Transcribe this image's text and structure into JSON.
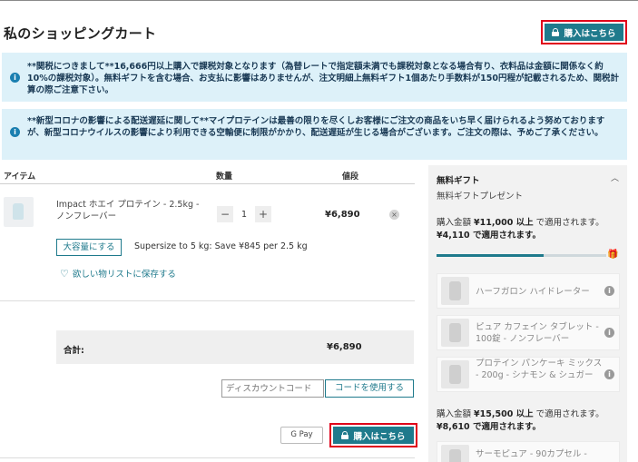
{
  "page": {
    "title": "私のショッピングカート"
  },
  "checkout": {
    "label": "購入はこちら"
  },
  "notices": [
    {
      "text": "**関税につきまして**16,666円以上購入で課税対象となります（為替レートで指定額未満でも課税対象となる場合有り、衣料品は金額に関係なく約10%の課税対象）。無料ギフトを含む場合、お支払に影響はありませんが、注文明細上無料ギフト1個あたり手数料が150円程が記載されるため、関税計算の際ご注意下さい。"
    },
    {
      "text": "**新型コロナの影響による配送遅延に関して**マイプロテインは最善の限りを尽くしお客様にご注文の商品をいち早く届けられるよう努めておりますが、新型コロナウイルスの影響により利用できる空輸便に制限がかかり、配送遅延が生じる場合がございます。ご注文の際は、予めご了承ください。"
    }
  ],
  "table": {
    "headers": {
      "item": "アイテム",
      "qty": "数量",
      "price": "値段"
    }
  },
  "line_item": {
    "name": "Impact ホエイ プロテイン - 2.5kg - ノンフレーバー",
    "minus": "−",
    "quantity": "1",
    "plus": "+",
    "price": "¥6,890",
    "remove": "×",
    "upsize_label": "大容量にする",
    "upsize_text": "Supersize to 5 kg: Save ¥845 per 2.5 kg",
    "wishlist_label": "欲しい物リストに保存する"
  },
  "summary": {
    "total_label": "合計:",
    "total_value": "¥6,890"
  },
  "discount": {
    "placeholder": "ディスカウントコード",
    "apply_label": "コードを使用する"
  },
  "gpay": {
    "label": "G Pay"
  },
  "gifts": {
    "title": "無料ギフト",
    "subtitle": "無料ギフトプレゼント",
    "tier1": {
      "prefix": "購入金額 ",
      "amount": "¥11,000 以上",
      "suffix": " で適用されます。",
      "remaining": "¥4,110 で適用されます。"
    },
    "progress": 0.63,
    "items": [
      {
        "name": "ハーフガロン ハイドレーター"
      },
      {
        "name": "ピュア カフェイン タブレット - 100錠 - ノンフレーバー"
      },
      {
        "name": "プロテイン パンケーキ ミックス - 200g - シナモン & シュガー"
      }
    ],
    "tier2": {
      "prefix": "購入金額 ",
      "amount": "¥15,500 以上",
      "suffix": " で適用されます。",
      "remaining": "¥8,610 で適用されます。"
    },
    "tier2_items": [
      {
        "name": "サーモピュア - 90カプセル -"
      }
    ]
  },
  "colors": {
    "accent": "#1f7a8c",
    "highlight": "#e0001a",
    "notice_bg": "#ddf1f9"
  }
}
